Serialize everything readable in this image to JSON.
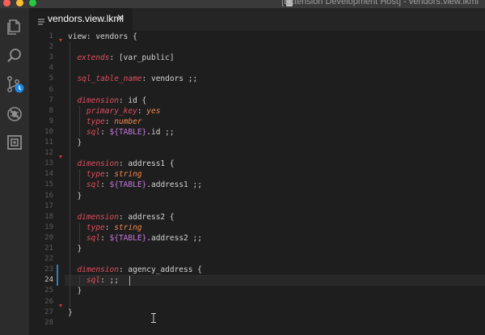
{
  "window": {
    "title": "[Extension Development Host] - vendors.view.lkml"
  },
  "activity_bar": {
    "icons": [
      "files-icon",
      "search-icon",
      "source-control-icon",
      "debug-icon",
      "extensions-icon"
    ]
  },
  "tab": {
    "label": "vendors.view.lkml",
    "close": "✕"
  },
  "editor": {
    "active_line": 24,
    "line_numbers": [
      "1",
      "2",
      "3",
      "4",
      "5",
      "6",
      "7",
      "8",
      "9",
      "10",
      "11",
      "12",
      "13",
      "14",
      "15",
      "16",
      "17",
      "18",
      "19",
      "20",
      "21",
      "22",
      "23",
      "24",
      "25",
      "26",
      "27",
      "28"
    ],
    "fold_markers_at": [
      2,
      13,
      27
    ],
    "lines": [
      [
        {
          "t": "txt",
          "v": "view: vendors {"
        }
      ],
      [],
      [
        {
          "t": "txt",
          "v": "  "
        },
        {
          "t": "key",
          "v": "extends"
        },
        {
          "t": "txt",
          "v": ": [var_public]"
        }
      ],
      [],
      [
        {
          "t": "txt",
          "v": "  "
        },
        {
          "t": "key",
          "v": "sql_table_name"
        },
        {
          "t": "txt",
          "v": ": vendors ;;"
        }
      ],
      [],
      [
        {
          "t": "txt",
          "v": "  "
        },
        {
          "t": "key",
          "v": "dimension"
        },
        {
          "t": "txt",
          "v": ": id {"
        }
      ],
      [
        {
          "t": "txt",
          "v": "    "
        },
        {
          "t": "key",
          "v": "primary_key"
        },
        {
          "t": "txt",
          "v": ": "
        },
        {
          "t": "val",
          "v": "yes"
        }
      ],
      [
        {
          "t": "txt",
          "v": "    "
        },
        {
          "t": "key",
          "v": "type"
        },
        {
          "t": "txt",
          "v": ": "
        },
        {
          "t": "val",
          "v": "number"
        }
      ],
      [
        {
          "t": "txt",
          "v": "    "
        },
        {
          "t": "key",
          "v": "sql"
        },
        {
          "t": "txt",
          "v": ": "
        },
        {
          "t": "var",
          "v": "${TABLE}"
        },
        {
          "t": "txt",
          "v": ".id ;;"
        }
      ],
      [
        {
          "t": "txt",
          "v": "  }"
        }
      ],
      [],
      [
        {
          "t": "txt",
          "v": "  "
        },
        {
          "t": "key",
          "v": "dimension"
        },
        {
          "t": "txt",
          "v": ": address1 {"
        }
      ],
      [
        {
          "t": "txt",
          "v": "    "
        },
        {
          "t": "key",
          "v": "type"
        },
        {
          "t": "txt",
          "v": ": "
        },
        {
          "t": "val",
          "v": "string"
        }
      ],
      [
        {
          "t": "txt",
          "v": "    "
        },
        {
          "t": "key",
          "v": "sql"
        },
        {
          "t": "txt",
          "v": ": "
        },
        {
          "t": "var",
          "v": "${TABLE}"
        },
        {
          "t": "txt",
          "v": ".address1 ;;"
        }
      ],
      [
        {
          "t": "txt",
          "v": "  }"
        }
      ],
      [],
      [
        {
          "t": "txt",
          "v": "  "
        },
        {
          "t": "key",
          "v": "dimension"
        },
        {
          "t": "txt",
          "v": ": address2 {"
        }
      ],
      [
        {
          "t": "txt",
          "v": "    "
        },
        {
          "t": "key",
          "v": "type"
        },
        {
          "t": "txt",
          "v": ": "
        },
        {
          "t": "val",
          "v": "string"
        }
      ],
      [
        {
          "t": "txt",
          "v": "    "
        },
        {
          "t": "key",
          "v": "sql"
        },
        {
          "t": "txt",
          "v": ": "
        },
        {
          "t": "var",
          "v": "${TABLE}"
        },
        {
          "t": "txt",
          "v": ".address2 ;;"
        }
      ],
      [
        {
          "t": "txt",
          "v": "  }"
        }
      ],
      [],
      [
        {
          "t": "txt",
          "v": "  "
        },
        {
          "t": "key",
          "v": "dimension"
        },
        {
          "t": "txt",
          "v": ": agency_address {"
        }
      ],
      [
        {
          "t": "txt",
          "v": "    "
        },
        {
          "t": "key",
          "v": "sql"
        },
        {
          "t": "txt",
          "v": ": ;;"
        }
      ],
      [
        {
          "t": "txt",
          "v": "  }"
        }
      ],
      [],
      [
        {
          "t": "txt",
          "v": "}"
        }
      ],
      []
    ]
  },
  "colors": {
    "keyword": "#e04f5f",
    "value": "#f08a4c",
    "variable": "#c678dd",
    "text": "#d4d4d4",
    "accent": "#2f7fbf"
  }
}
